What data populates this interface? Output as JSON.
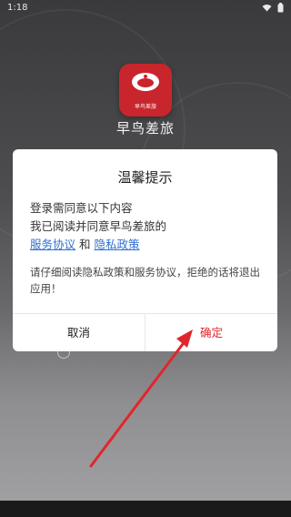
{
  "statusbar": {
    "time": "1:18"
  },
  "app": {
    "name": "早鸟差旅",
    "logo_text": "早鸟差旅",
    "brand_color": "#c9252c"
  },
  "dialog": {
    "title": "温馨提示",
    "line1": "登录需同意以下内容",
    "line2": "我已阅读并同意早鸟差旅的",
    "link_service": "服务协议",
    "and_text": "和",
    "link_privacy": "隐私政策",
    "note": "请仔细阅读隐私政策和服务协议，拒绝的话将退出应用！",
    "cancel_label": "取消",
    "confirm_label": "确定",
    "link_color": "#2f6fd0",
    "confirm_color": "#e0262d"
  },
  "annotation": {
    "arrow_color": "#e0262d",
    "points_to": "confirm-button"
  }
}
